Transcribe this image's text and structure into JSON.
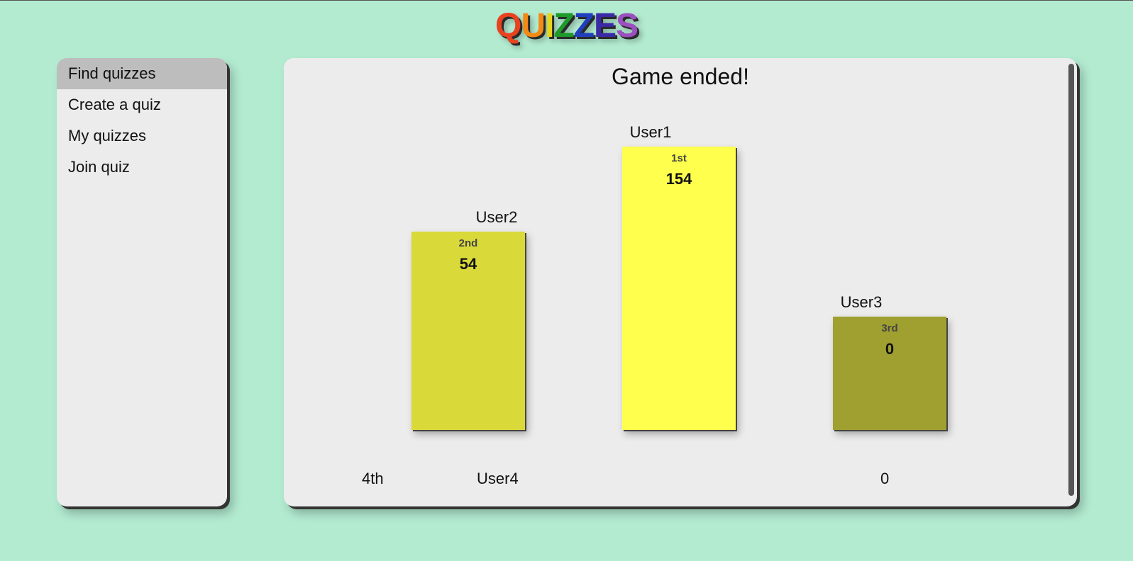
{
  "logo": {
    "letters": [
      "Q",
      "U",
      "I",
      "Z",
      "Z",
      "E",
      "S"
    ],
    "colors": [
      "#e8431f",
      "#f28a14",
      "#e7d51a",
      "#1e9a2a",
      "#1f3fbf",
      "#3a2aa8",
      "#9b4fc0"
    ]
  },
  "sidebar": {
    "items": [
      {
        "label": "Find quizzes",
        "active": true
      },
      {
        "label": "Create a quiz",
        "active": false
      },
      {
        "label": "My quizzes",
        "active": false
      },
      {
        "label": "Join quiz",
        "active": false
      }
    ]
  },
  "main": {
    "title": "Game ended!",
    "podium": [
      {
        "name": "User2",
        "rank": "2nd",
        "score": "54",
        "color": "#d9d93a"
      },
      {
        "name": "User1",
        "rank": "1st",
        "score": "154",
        "color": "#ffff4d"
      },
      {
        "name": "User3",
        "rank": "3rd",
        "score": "0",
        "color": "#a0a030"
      }
    ],
    "others": [
      {
        "rank": "4th",
        "name": "User4",
        "score": "0"
      }
    ]
  },
  "colors": {
    "background": "#b3ebd1",
    "panel": "#ececec",
    "active_nav": "#bdbdbd"
  }
}
